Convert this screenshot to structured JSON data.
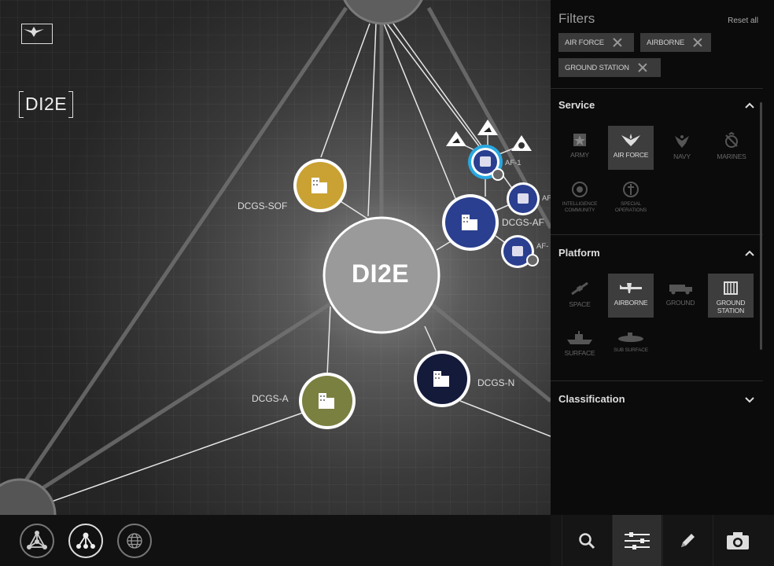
{
  "app": {
    "brand": "DI2E"
  },
  "graph": {
    "center_label": "DI2E",
    "nodes": [
      {
        "id": "dcgs-sof",
        "label": "DCGS-SOF",
        "color": "#c9a233"
      },
      {
        "id": "dcgs-af",
        "label": "DCGS-AF",
        "color": "#2a3f8f"
      },
      {
        "id": "dcgs-a",
        "label": "DCGS-A",
        "color": "#7a8040"
      },
      {
        "id": "dcgs-n",
        "label": "DCGS-N",
        "color": "#141a3a"
      },
      {
        "id": "af-1",
        "label": "AF-1",
        "color": "#2a3f8f"
      },
      {
        "id": "af-2",
        "label": "AF",
        "color": "#2a3f8f"
      },
      {
        "id": "af-3",
        "label": "AF-",
        "color": "#2a3f8f"
      }
    ]
  },
  "bottom_toolbar": {
    "modes": [
      "network-view",
      "hierarchy-view",
      "globe-view"
    ],
    "active_mode": "hierarchy-view"
  },
  "filters": {
    "title": "Filters",
    "reset_label": "Reset all",
    "chips": [
      "AIR FORCE",
      "AIRBORNE",
      "GROUND STATION"
    ],
    "sections": {
      "service": {
        "title": "Service",
        "items": [
          {
            "label": "ARMY",
            "icon": "army-star-icon",
            "selected": false
          },
          {
            "label": "AIR FORCE",
            "icon": "air-force-wings-icon",
            "selected": true
          },
          {
            "label": "NAVY",
            "icon": "navy-eagle-icon",
            "selected": false
          },
          {
            "label": "MARINES",
            "icon": "marines-emblem-icon",
            "selected": false
          },
          {
            "label": "INTELLIGENCE COMMUNITY",
            "icon": "intelligence-seal-icon",
            "selected": false
          },
          {
            "label": "SPECIAL OPERATIONS",
            "icon": "special-ops-seal-icon",
            "selected": false
          }
        ]
      },
      "platform": {
        "title": "Platform",
        "items": [
          {
            "label": "SPACE",
            "icon": "satellite-icon",
            "selected": false
          },
          {
            "label": "AIRBORNE",
            "icon": "aircraft-icon",
            "selected": true
          },
          {
            "label": "GROUND",
            "icon": "ground-vehicle-icon",
            "selected": false
          },
          {
            "label": "GROUND STATION",
            "icon": "ground-station-icon",
            "selected": true
          },
          {
            "label": "SURFACE",
            "icon": "ship-icon",
            "selected": false
          },
          {
            "label": "SUB SURFACE",
            "icon": "submarine-icon",
            "selected": false
          }
        ]
      },
      "classification": {
        "title": "Classification"
      }
    }
  },
  "bottom_right": {
    "buttons": [
      "search",
      "filters",
      "edit",
      "camera"
    ],
    "active": "filters"
  },
  "colors": {
    "panel_bg": "#0b0b0b",
    "chip_bg": "#3a3a3a",
    "selected_tile": "#3d3d3d",
    "accent_ring": "#29a8e0"
  }
}
